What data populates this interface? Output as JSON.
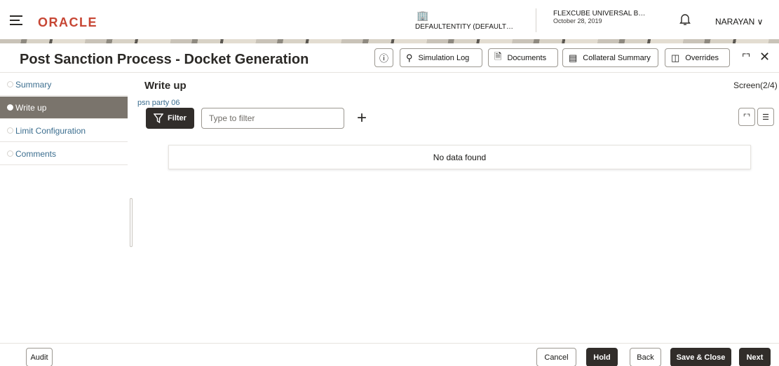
{
  "header": {
    "logo": "ORACLE",
    "entity": "DEFAULTENTITY (DEFAULT…",
    "branch_name": "FLEXCUBE UNIVERSAL B…",
    "branch_date": "October 28, 2019",
    "user": "NARAYAN ∨"
  },
  "titlebar": {
    "title": "Post Sanction Process - Docket Generation",
    "info_icon": "ⓘ",
    "buttons": {
      "simulation_log": "Simulation Log",
      "documents": "Documents",
      "collateral_summary": "Collateral Summary",
      "overrides": "Overrides"
    }
  },
  "sidebar": {
    "items": [
      {
        "label": "Summary"
      },
      {
        "label": "Write up"
      },
      {
        "label": "Limit Configuration"
      },
      {
        "label": "Comments"
      }
    ]
  },
  "main": {
    "section_title": "Write up",
    "screen_count": "Screen(2/4)",
    "party_name": "psn party 06",
    "filter_label": "Filter",
    "filter_placeholder": "Type to filter",
    "empty_message": "No data found"
  },
  "footer": {
    "audit": "Audit",
    "cancel": "Cancel",
    "hold": "Hold",
    "back": "Back",
    "save_close": "Save & Close",
    "next": "Next"
  },
  "colors": {
    "brand": "#c74634",
    "link": "#3c6e8f",
    "dark_button": "#312d2a",
    "active_nav": "#7a746c"
  }
}
